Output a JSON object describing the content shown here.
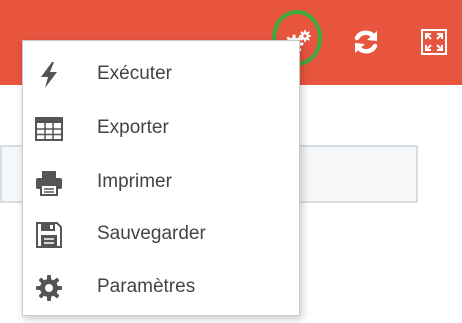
{
  "colors": {
    "toolbar_bg": "#e8553f",
    "highlight": "#3fa83f",
    "menu_text": "#444444",
    "icon_gray": "#555555"
  },
  "toolbar": {
    "icons": [
      "gears-icon",
      "refresh-icon",
      "fullscreen-icon"
    ]
  },
  "menu": {
    "items": [
      {
        "label": "Exécuter",
        "icon": "lightning-icon"
      },
      {
        "label": "Exporter",
        "icon": "table-grid-icon"
      },
      {
        "label": "Imprimer",
        "icon": "printer-icon"
      },
      {
        "label": "Sauvegarder",
        "icon": "floppy-disk-icon"
      },
      {
        "label": "Paramètres",
        "icon": "gear-icon"
      }
    ]
  }
}
